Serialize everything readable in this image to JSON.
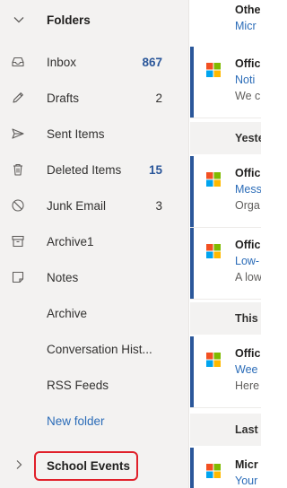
{
  "folders": {
    "header": "Folders",
    "items": [
      {
        "label": "Inbox",
        "count": "867",
        "icon": "inbox-icon"
      },
      {
        "label": "Drafts",
        "count": "2",
        "icon": "pencil-icon"
      },
      {
        "label": "Sent Items",
        "count": "",
        "icon": "send-icon"
      },
      {
        "label": "Deleted Items",
        "count": "15",
        "icon": "trash-icon"
      },
      {
        "label": "Junk Email",
        "count": "3",
        "icon": "block-icon"
      },
      {
        "label": "Archive1",
        "count": "",
        "icon": "archive-icon"
      },
      {
        "label": "Notes",
        "count": "",
        "icon": "note-icon"
      },
      {
        "label": "Archive",
        "count": ""
      },
      {
        "label": "Conversation Hist...",
        "count": ""
      },
      {
        "label": "RSS Feeds",
        "count": ""
      }
    ],
    "new_folder": "New folder",
    "school_events": "School Events"
  },
  "messages": {
    "top": {
      "sender": "Othe",
      "subject": "Micr"
    },
    "groups": [
      {
        "title": "Yeste"
      },
      {
        "title": "This"
      },
      {
        "title": "Last"
      }
    ],
    "items": [
      {
        "sender": "Offic",
        "subject": "Noti",
        "preview": "We c"
      },
      {
        "sender": "Offic",
        "subject": "Mess",
        "preview": "Orga"
      },
      {
        "sender": "Offic",
        "subject": "Low-",
        "preview": "A low"
      },
      {
        "sender": "Offic",
        "subject": "Wee",
        "preview": "Here"
      },
      {
        "sender": "Micr",
        "subject": "Your",
        "preview": ""
      }
    ]
  },
  "colors": {
    "accent": "#2b579a",
    "link": "#2b6cb8",
    "highlight": "#e0202a",
    "pane_bg": "#f3f2f1"
  }
}
